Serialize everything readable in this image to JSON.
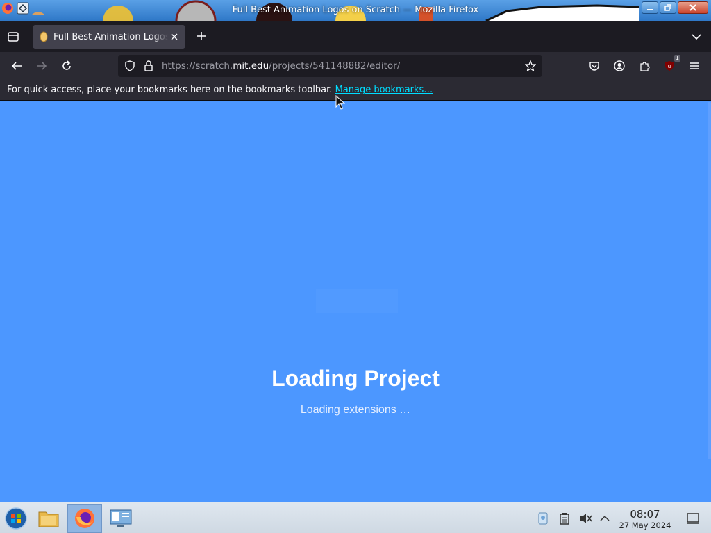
{
  "window": {
    "title": "Full Best Animation Logos on Scratch — Mozilla Firefox"
  },
  "tabs": [
    {
      "title": "Full Best Animation Logos on Scratch",
      "active": true
    }
  ],
  "navbar": {
    "url_prefix": "https://scratch.",
    "url_host": "mit.edu",
    "url_path": "/projects/541148882/editor/",
    "extension_badge": "1"
  },
  "bookmarks_bar": {
    "message": "For quick access, place your bookmarks here on the bookmarks toolbar.",
    "link": "Manage bookmarks…"
  },
  "content": {
    "loading_title": "Loading Project",
    "loading_status": "Loading extensions …",
    "background_color": "#4c97ff"
  },
  "taskbar": {
    "items": [
      "start-menu",
      "file-manager",
      "firefox",
      "system-settings"
    ],
    "active_item": "firefox",
    "clock_time": "08:07",
    "clock_date": "27 May 2024"
  },
  "colors": {
    "tabstrip": "#1c1b22",
    "toolbar": "#2b2a33",
    "link": "#00ddff",
    "scratch_blue": "#4c97ff"
  }
}
